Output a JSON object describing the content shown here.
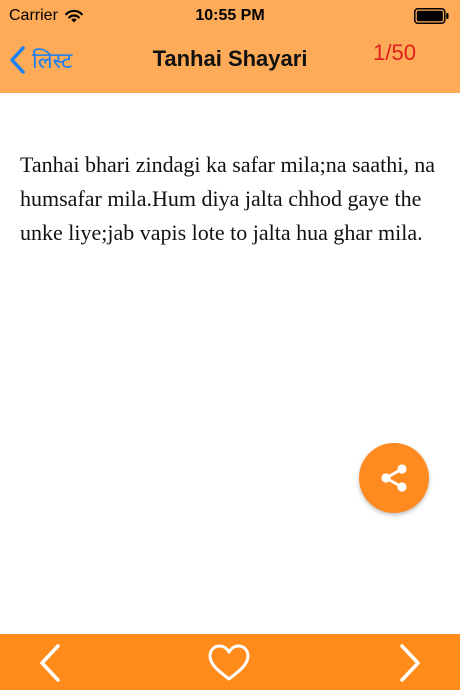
{
  "status_bar": {
    "carrier": "Carrier",
    "time": "10:55 PM"
  },
  "nav": {
    "back_label": "लिस्ट",
    "title": "Tanhai Shayari",
    "counter": "1/50"
  },
  "content": {
    "text": "Tanhai bhari zindagi ka safar mila;na saathi, na humsafar mila.Hum diya jalta chhod gaye the unke liye;jab vapis lote to jalta hua ghar mila."
  },
  "icons": {
    "wifi": "wifi-icon",
    "battery": "battery-icon",
    "back": "chevron-left-icon",
    "share": "share-icon",
    "prev": "chevron-left-icon",
    "favorite": "heart-icon",
    "next": "chevron-right-icon"
  },
  "colors": {
    "header_bg": "#FDAB58",
    "footer_bg": "#FF8C1A",
    "share_bg": "#FF8A1F",
    "back_tint": "#1a7ff0",
    "counter": "#e0201c"
  }
}
